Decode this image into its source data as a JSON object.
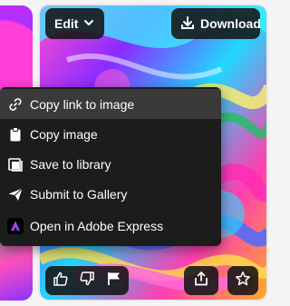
{
  "toolbar": {
    "edit_label": "Edit",
    "download_label": "Download"
  },
  "context_menu": {
    "items": [
      {
        "label": "Copy link to image",
        "icon": "link-icon"
      },
      {
        "label": "Copy image",
        "icon": "clipboard-icon"
      },
      {
        "label": "Save to library",
        "icon": "library-icon"
      },
      {
        "label": "Submit to Gallery",
        "icon": "send-icon"
      },
      {
        "label": "Open in Adobe Express",
        "icon": "adobe-express-icon"
      }
    ]
  },
  "bottom_actions": {
    "icons": [
      "thumbs-up-icon",
      "thumbs-down-icon",
      "flag-icon",
      "share-icon",
      "star-icon"
    ]
  },
  "colors": {
    "menu_bg": "#1c1c1c",
    "menu_highlight": "#3a3a3a",
    "overlay_button_bg": "#141414"
  }
}
